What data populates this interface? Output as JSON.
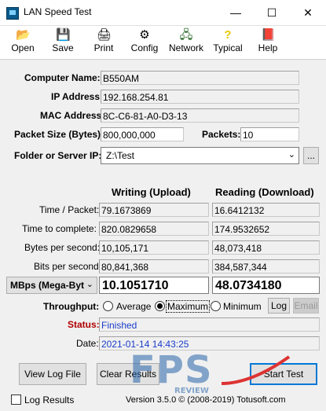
{
  "window": {
    "title": "LAN Speed Test",
    "minimize": "—",
    "maximize": "☐",
    "close": "✕"
  },
  "toolbar": {
    "open": "Open",
    "save": "Save",
    "print": "Print",
    "config": "Config",
    "network": "Network",
    "typical": "Typical",
    "help": "Help"
  },
  "info": {
    "computer_name_label": "Computer Name:",
    "computer_name": "B550AM",
    "ip_label": "IP Address:",
    "ip": "192.168.254.81",
    "mac_label": "MAC Address:",
    "mac": "8C-C6-81-A0-D3-13",
    "packet_size_label": "Packet Size (Bytes):",
    "packet_size": "800,000,000",
    "packets_label": "Packets:",
    "packets": "10",
    "folder_label": "Folder or Server IP:",
    "folder": "Z:\\Test",
    "browse": "..."
  },
  "results": {
    "writing_header": "Writing (Upload)",
    "reading_header": "Reading (Download)",
    "time_packet_label": "Time / Packet:",
    "write_time_packet": "79.1673869",
    "read_time_packet": "16.6412132",
    "time_complete_label": "Time to complete:",
    "write_time_complete": "820.0829658",
    "read_time_complete": "174.9532652",
    "bytes_label": "Bytes per second:",
    "write_bytes": "10,105,171",
    "read_bytes": "48,073,418",
    "bits_label": "Bits per second:",
    "write_bits": "80,841,368",
    "read_bits": "384,587,344",
    "unit_select": "MBps (Mega-Byt",
    "write_speed": "10.1051710",
    "read_speed": "48.0734180"
  },
  "throughput": {
    "label": "Throughput:",
    "average": "Average",
    "maximum": "Maximum",
    "minimum": "Minimum",
    "selected": "maximum",
    "log": "Log",
    "email": "Email"
  },
  "status": {
    "status_label": "Status:",
    "status_value": "Finished",
    "date_label": "Date:",
    "date_value": "2021-01-14 14:43:25"
  },
  "actions": {
    "view_log": "View Log File",
    "clear": "Clear Results",
    "start": "Start Test"
  },
  "footer": {
    "log_results": "Log Results",
    "version": "Version 3.5.0  © (2008-2019)  Totusoft.com"
  },
  "watermark": {
    "big": "FPS",
    "small": "REVIEW"
  },
  "colors": {
    "status_label": "#b00000",
    "value_blue": "#1a3cc8"
  }
}
